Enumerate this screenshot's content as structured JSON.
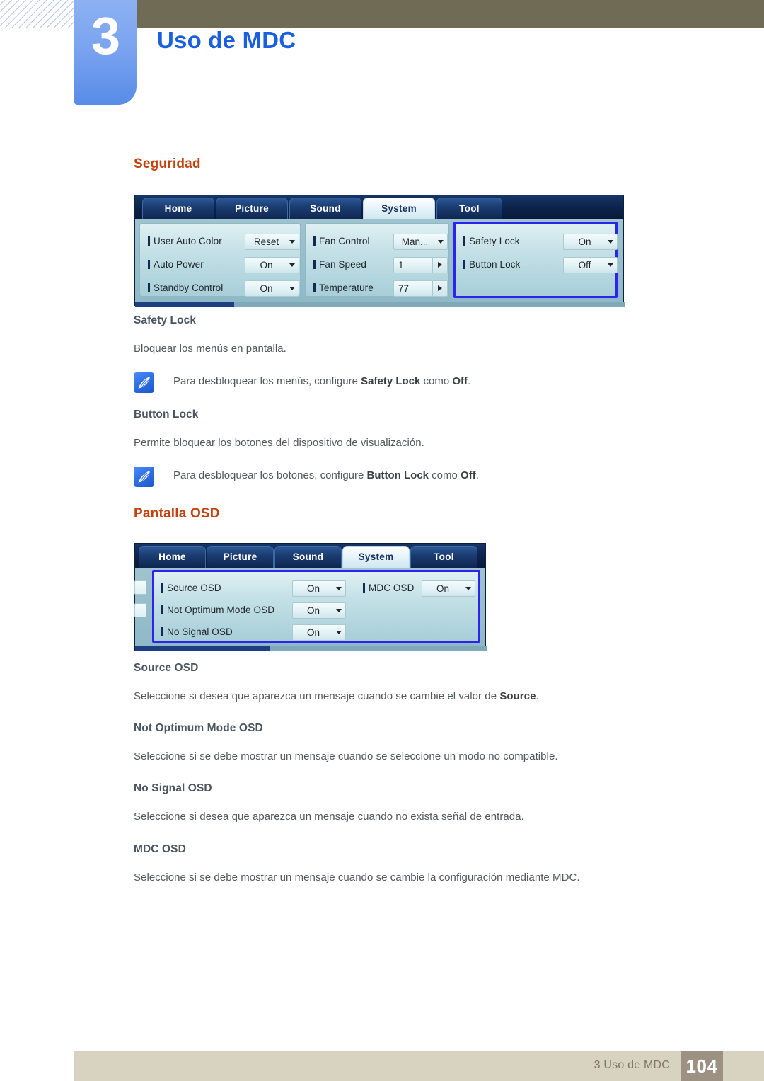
{
  "header": {
    "chapter_number": "3",
    "chapter_title": "Uso de MDC"
  },
  "sections": {
    "seguridad_heading": "Seguridad",
    "pantalla_heading": "Pantalla OSD"
  },
  "topics": {
    "safety_lock": {
      "title": "Safety Lock",
      "body": "Bloquear los menús en pantalla.",
      "note_prefix": "Para desbloquear los menús, configure ",
      "note_bold1": "Safety Lock",
      "note_mid": " como ",
      "note_bold2": "Off",
      "note_suffix": "."
    },
    "button_lock": {
      "title": "Button Lock",
      "body": "Permite bloquear los botones del dispositivo de visualización.",
      "note_prefix": "Para desbloquear los botones, configure ",
      "note_bold1": "Button Lock",
      "note_mid": " como ",
      "note_bold2": "Off",
      "note_suffix": "."
    },
    "source_osd": {
      "title": "Source OSD",
      "body_prefix": "Seleccione si desea que aparezca un mensaje cuando se cambie el valor de ",
      "body_bold": "Source",
      "body_suffix": "."
    },
    "not_optimum_mode_osd": {
      "title": "Not Optimum Mode OSD",
      "body": "Seleccione si se debe mostrar un mensaje cuando se seleccione un modo no compatible."
    },
    "no_signal_osd": {
      "title": "No Signal OSD",
      "body": "Seleccione si desea que aparezca un mensaje cuando no exista señal de entrada."
    },
    "mdc_osd": {
      "title": "MDC OSD",
      "body": "Seleccione si se debe mostrar un mensaje cuando se cambie la configuración mediante MDC."
    }
  },
  "mdc_system": {
    "tabs": [
      {
        "label": "Home",
        "active": false
      },
      {
        "label": "Picture",
        "active": false
      },
      {
        "label": "Sound",
        "active": false
      },
      {
        "label": "System",
        "active": true
      },
      {
        "label": "Tool",
        "active": false
      }
    ],
    "panel_left": [
      {
        "label": "User Auto Color",
        "value": "Reset",
        "type": "dropdown"
      },
      {
        "label": "Auto Power",
        "value": "On",
        "type": "dropdown"
      },
      {
        "label": "Standby Control",
        "value": "On",
        "type": "dropdown"
      }
    ],
    "panel_middle": [
      {
        "label": "Fan Control",
        "value": "Man...",
        "type": "dropdown"
      },
      {
        "label": "Fan Speed",
        "value": "1",
        "type": "spinner"
      },
      {
        "label": "Temperature",
        "value": "77",
        "type": "spinner"
      }
    ],
    "panel_right": [
      {
        "label": "Safety Lock",
        "value": "On",
        "type": "dropdown"
      },
      {
        "label": "Button Lock",
        "value": "Off",
        "type": "dropdown"
      }
    ]
  },
  "mdc_osd": {
    "tabs": [
      {
        "label": "Home",
        "active": false
      },
      {
        "label": "Picture",
        "active": false
      },
      {
        "label": "Sound",
        "active": false
      },
      {
        "label": "System",
        "active": true
      },
      {
        "label": "Tool",
        "active": false
      }
    ],
    "panel_left": [
      {
        "label": "Source OSD",
        "value": "On",
        "type": "dropdown"
      },
      {
        "label": "Not Optimum Mode OSD",
        "value": "On",
        "type": "dropdown"
      },
      {
        "label": "No Signal OSD",
        "value": "On",
        "type": "dropdown"
      }
    ],
    "panel_right": [
      {
        "label": "MDC OSD",
        "value": "On",
        "type": "dropdown"
      }
    ]
  },
  "footer": {
    "label": "3 Uso de MDC",
    "page": "104"
  },
  "colors": {
    "chapter_title": "#1a5fe0",
    "section_heading": "#c2410c",
    "header_bar": "#6f6b55",
    "footer_bar": "#d8d3c0",
    "footer_page_box": "#9c9183",
    "highlight_border": "#2a24ee"
  }
}
